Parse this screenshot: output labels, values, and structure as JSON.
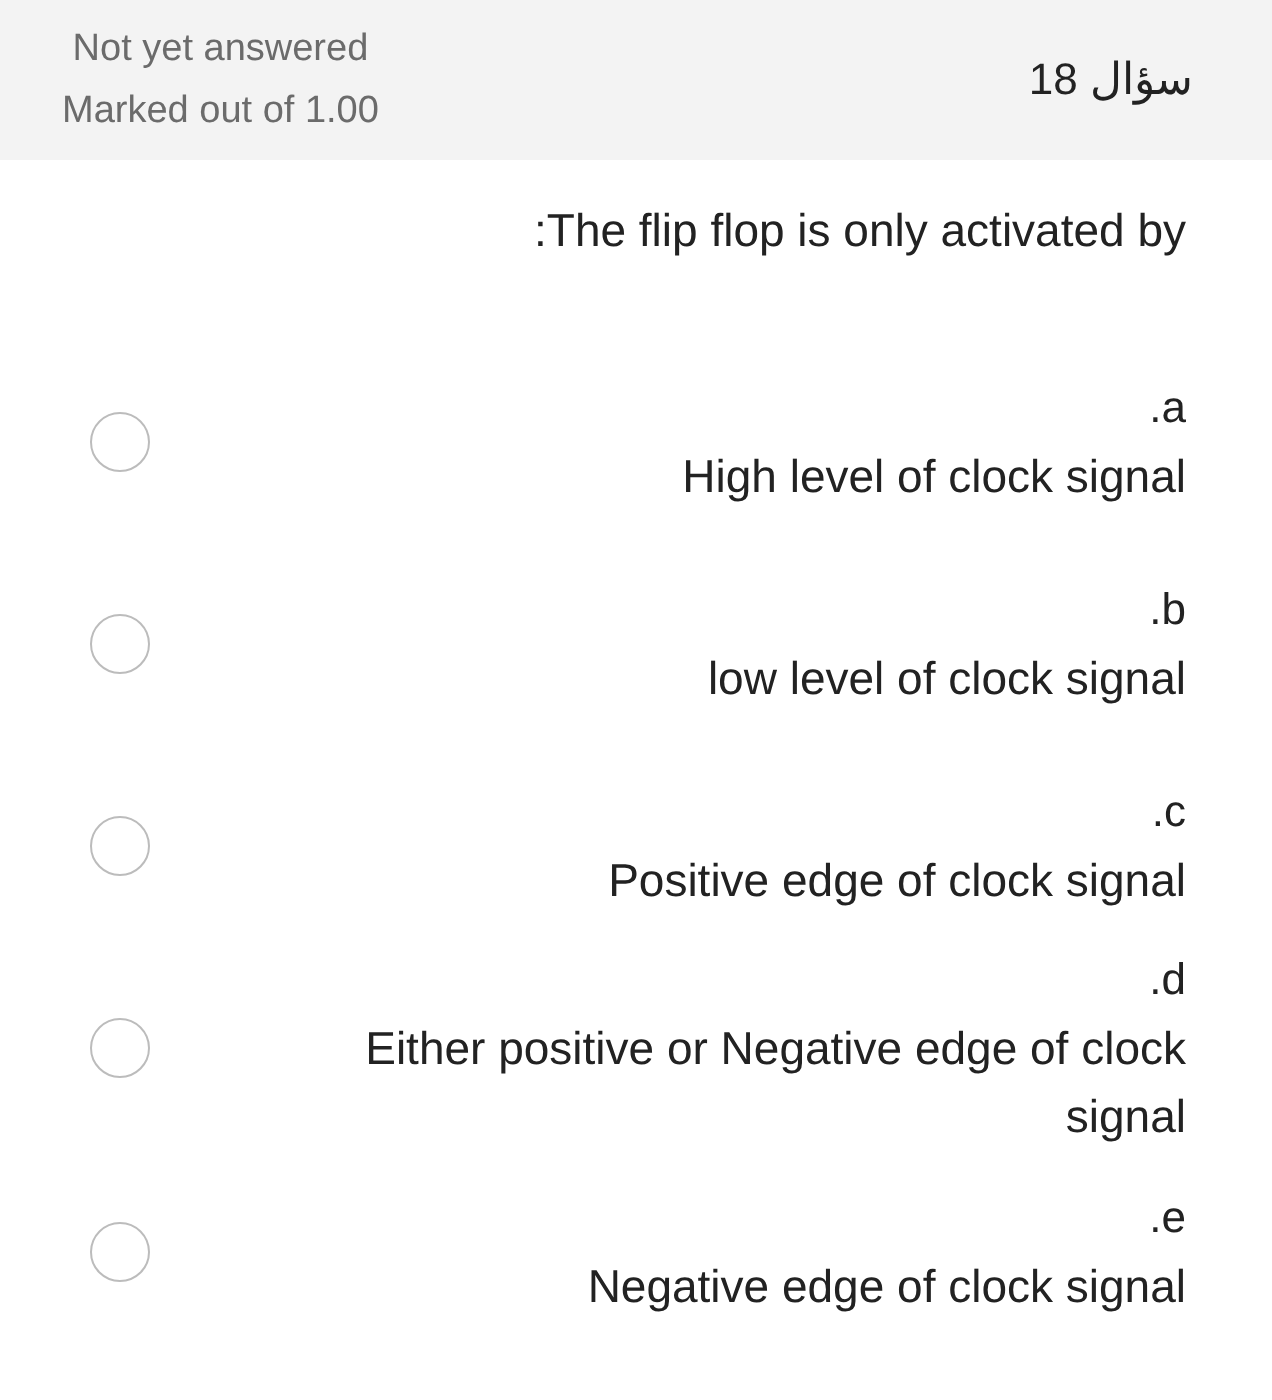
{
  "header": {
    "status": "Not yet answered",
    "marks": "Marked out of 1.00",
    "question_number": "سؤال 18"
  },
  "question": {
    "text": ":The flip flop is only activated by"
  },
  "options": [
    {
      "letter": ".a",
      "text": "High level of clock signal",
      "selected": false
    },
    {
      "letter": ".b",
      "text": "low level of clock signal",
      "selected": false
    },
    {
      "letter": ".c",
      "text": "Positive edge of clock signal",
      "selected": false
    },
    {
      "letter": ".d",
      "text": "Either positive or Negative edge of clock signal",
      "selected": false
    },
    {
      "letter": ".e",
      "text": "Negative edge of clock signal",
      "selected": false
    }
  ]
}
